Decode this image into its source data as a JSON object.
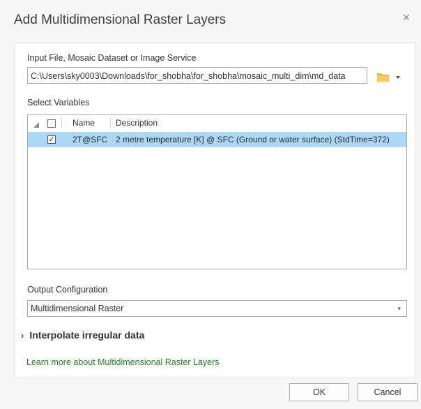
{
  "dialog": {
    "title": "Add Multidimensional Raster Layers",
    "close_glyph": "×"
  },
  "input": {
    "label": "Input File, Mosaic Dataset or Image Service",
    "value": "C:\\Users\\sky0003\\Downloads\\for_shobha\\for_shobha\\mosaic_multi_dim\\md_data",
    "browse_icon": "folder-icon",
    "dropdown_glyph": "▾"
  },
  "variables": {
    "label": "Select Variables",
    "columns": [
      "Name",
      "Description"
    ],
    "rows": [
      {
        "checked": true,
        "check_glyph": "✓",
        "name": "2T@SFC",
        "description": "2 metre temperature [K] @ SFC (Ground or water surface) (StdTime=372)"
      }
    ]
  },
  "output": {
    "label": "Output Configuration",
    "value": "Multidimensional Raster",
    "dropdown_glyph": "▾"
  },
  "interpolate": {
    "chevron": "›",
    "label": "Interpolate irregular data"
  },
  "help_link": "Learn more about Multidimensional Raster Layers",
  "buttons": {
    "ok": "OK",
    "cancel": "Cancel"
  },
  "colors": {
    "selected_row": "#add8f5",
    "link": "#2b7a2b",
    "folder": "#f2c94c"
  }
}
